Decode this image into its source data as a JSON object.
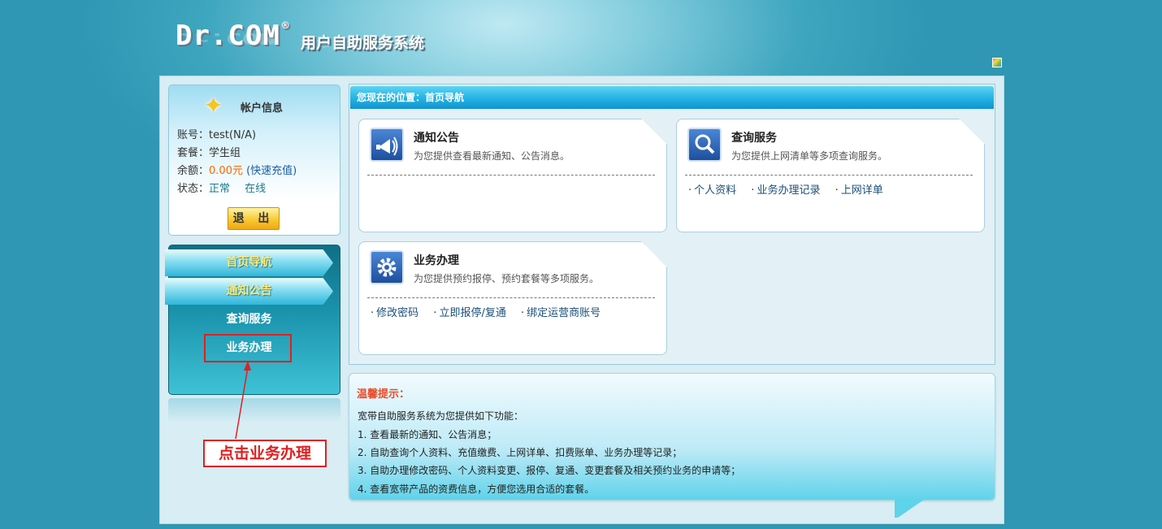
{
  "header": {
    "logo_text": "Dr.COM",
    "logo_reg": "®",
    "system_title": "用户自助服务系统"
  },
  "account": {
    "title": "帐户信息",
    "account_label": "账号：",
    "account_value": "test(N/A)",
    "plan_label": "套餐：",
    "plan_value": "学生组",
    "balance_label": "余额：",
    "balance_value": "0.00元",
    "recharge_link": "(快速充值)",
    "status_label": "状态：",
    "status_value": "正常",
    "online_value": "在线",
    "logout_label": "退 出"
  },
  "nav": {
    "items": [
      {
        "label": "首页导航"
      },
      {
        "label": "通知公告"
      },
      {
        "label": "查询服务"
      },
      {
        "label": "业务办理"
      }
    ]
  },
  "annotation": {
    "callout_text": "点击业务办理"
  },
  "breadcrumb": {
    "text": "您现在的位置：首页导航"
  },
  "cards": {
    "notice": {
      "title": "通知公告",
      "desc": "为您提供查看最新通知、公告消息。",
      "icon": "megaphone-icon"
    },
    "query": {
      "title": "查询服务",
      "desc": "为您提供上网清单等多项查询服务。",
      "icon": "magnifier-icon",
      "links": [
        "个人资料",
        "业务办理记录",
        "上网详单"
      ]
    },
    "business": {
      "title": "业务办理",
      "desc": "为您提供预约报停、预约套餐等多项服务。",
      "icon": "gear-icon",
      "links": [
        "修改密码",
        "立即报停/复通",
        "绑定运营商账号"
      ]
    }
  },
  "tips": {
    "title": "温馨提示：",
    "intro": "宽带自助服务系统为您提供如下功能：",
    "lines": [
      "1. 查看最新的通知、公告消息；",
      "2. 自助查询个人资料、充值缴费、上网详单、扣费账单、业务办理等记录；",
      "3. 自助办理修改密码、个人资料变更、报停、复通、变更套餐及相关预约业务的申请等；",
      "4. 查看宽带产品的资费信息，方便您选用合适的套餐。"
    ]
  }
}
